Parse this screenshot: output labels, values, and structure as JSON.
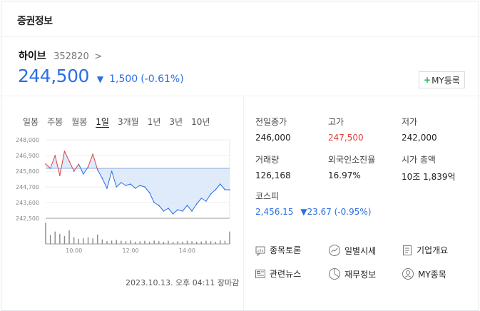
{
  "header": {
    "title": "증권정보"
  },
  "stock": {
    "name": "하이브",
    "code": "352820",
    "code_chevron": ">",
    "price": "244,500",
    "change": "1,500",
    "change_pct": "(-0.61%)",
    "direction_icon": "triangle-down-icon",
    "my_button": "MY등록"
  },
  "periods": [
    "일봉",
    "주봉",
    "월봉",
    "1일",
    "3개월",
    "1년",
    "3년",
    "10년"
  ],
  "selected_period": "1일",
  "chart_data": {
    "type": "line",
    "y_ticks": [
      "248,000",
      "246,900",
      "245,800",
      "244,700",
      "243,600",
      "242,500"
    ],
    "x_ticks": [
      "10:00",
      "12:00",
      "14:00"
    ],
    "ylim": [
      242500,
      248000
    ],
    "previous_close": 246000,
    "x": [
      "09:00",
      "09:10",
      "09:20",
      "09:30",
      "09:40",
      "09:50",
      "10:00",
      "10:10",
      "10:20",
      "10:30",
      "10:40",
      "10:50",
      "11:00",
      "11:10",
      "11:20",
      "11:30",
      "11:40",
      "11:50",
      "12:00",
      "12:10",
      "12:20",
      "12:30",
      "12:40",
      "12:50",
      "13:00",
      "13:10",
      "13:20",
      "13:30",
      "13:40",
      "13:50",
      "14:00",
      "14:10",
      "14:20",
      "14:30",
      "14:40",
      "14:50",
      "15:00",
      "15:10",
      "15:20",
      "15:30"
    ],
    "values": [
      246300,
      246000,
      246900,
      245500,
      247200,
      246500,
      245800,
      246300,
      245600,
      246100,
      247000,
      245900,
      245300,
      244600,
      245800,
      244700,
      245000,
      244800,
      244900,
      244600,
      244800,
      244700,
      244300,
      243600,
      243400,
      243000,
      243200,
      242800,
      243100,
      243000,
      243400,
      243000,
      243500,
      243900,
      243700,
      244200,
      244500,
      244900,
      244500,
      244500
    ],
    "volume": [
      95,
      40,
      55,
      45,
      35,
      60,
      30,
      22,
      25,
      30,
      25,
      42,
      20,
      12,
      15,
      18,
      14,
      12,
      16,
      10,
      12,
      14,
      10,
      15,
      12,
      10,
      14,
      9,
      12,
      10,
      14,
      12,
      10,
      11,
      14,
      12,
      10,
      16,
      14,
      55
    ],
    "up_color": "#e0413e",
    "down_color": "#2a6ee8"
  },
  "timestamp": "2023.10.13. 오후 04:11 장마감",
  "info": [
    {
      "label": "전일종가",
      "value": "246,000",
      "tone": ""
    },
    {
      "label": "고가",
      "value": "247,500",
      "tone": "red"
    },
    {
      "label": "저가",
      "value": "242,000",
      "tone": ""
    },
    {
      "label": "거래량",
      "value": "126,168",
      "tone": ""
    },
    {
      "label": "외국인소진율",
      "value": "16.97%",
      "tone": ""
    },
    {
      "label": "시가 총액",
      "value": "10조 1,839억",
      "tone": ""
    }
  ],
  "kospi": {
    "label": "코스피",
    "value": "2,456.15",
    "change": "▼23.67 (-0.95%)"
  },
  "links": [
    {
      "label": "종목토론",
      "icon": "chat-icon"
    },
    {
      "label": "일별시세",
      "icon": "trend-icon"
    },
    {
      "label": "기업개요",
      "icon": "document-icon"
    },
    {
      "label": "관련뉴스",
      "icon": "news-icon"
    },
    {
      "label": "재무정보",
      "icon": "pie-chart-icon"
    },
    {
      "label": "MY종목",
      "icon": "user-icon"
    }
  ]
}
